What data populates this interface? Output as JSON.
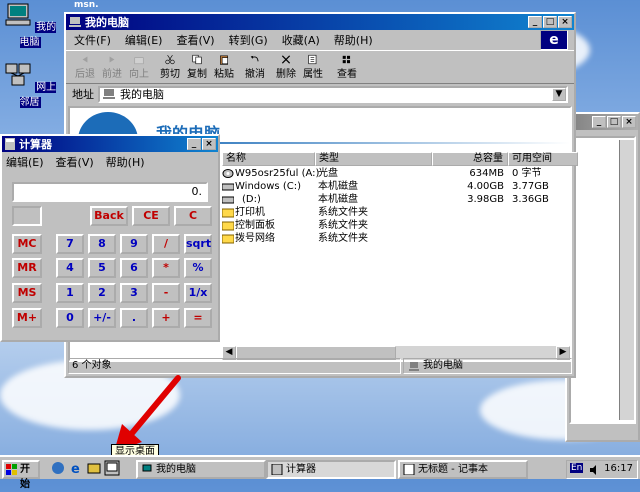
{
  "desktop": {
    "icons": [
      {
        "label": "我的电脑"
      },
      {
        "label": "网上邻居"
      }
    ]
  },
  "mycomputer": {
    "title": "我的电脑",
    "menu": [
      "文件(F)",
      "编辑(E)",
      "查看(V)",
      "转到(G)",
      "收藏(A)",
      "帮助(H)"
    ],
    "toolbar": [
      "后退",
      "前进",
      "向上",
      "剪切",
      "复制",
      "粘贴",
      "撤消",
      "删除",
      "属性",
      "查看"
    ],
    "address_label": "地址",
    "address_value": "我的电脑",
    "banner_title": "我的电脑",
    "columns": [
      "名称",
      "类型",
      "总容量",
      "可用空间"
    ],
    "rows": [
      {
        "name": "W95osr25ful (A:)",
        "type": "光盘",
        "total": "634MB",
        "free": "0 字节"
      },
      {
        "name": "Windows (C:)",
        "type": "本机磁盘",
        "total": "4.00GB",
        "free": "3.77GB"
      },
      {
        "name": "(D:)",
        "type": "本机磁盘",
        "total": "3.98GB",
        "free": "3.36GB"
      },
      {
        "name": "打印机",
        "type": "系统文件夹",
        "total": "",
        "free": ""
      },
      {
        "name": "控制面板",
        "type": "系统文件夹",
        "total": "",
        "free": ""
      },
      {
        "name": "拨号网络",
        "type": "系统文件夹",
        "total": "",
        "free": ""
      }
    ],
    "status_count": "6 个对象",
    "status_location": "我的电脑"
  },
  "calculator": {
    "title": "计算器",
    "menu": [
      "编辑(E)",
      "查看(V)",
      "帮助(H)"
    ],
    "display": "0.",
    "top_buttons": [
      "Back",
      "CE",
      "C"
    ],
    "mem_buttons": [
      "MC",
      "MR",
      "MS",
      "M+"
    ],
    "grid": [
      [
        "7",
        "8",
        "9",
        "/",
        "sqrt"
      ],
      [
        "4",
        "5",
        "6",
        "*",
        "%"
      ],
      [
        "1",
        "2",
        "3",
        "-",
        "1/x"
      ],
      [
        "0",
        "+/-",
        ".",
        "+",
        "="
      ]
    ]
  },
  "tooltip": "显示桌面",
  "taskbar": {
    "start": "开始",
    "tasks": [
      "我的电脑",
      "计算器",
      "无标题 - 记事本"
    ],
    "lang": "En",
    "clock": "16:17"
  }
}
